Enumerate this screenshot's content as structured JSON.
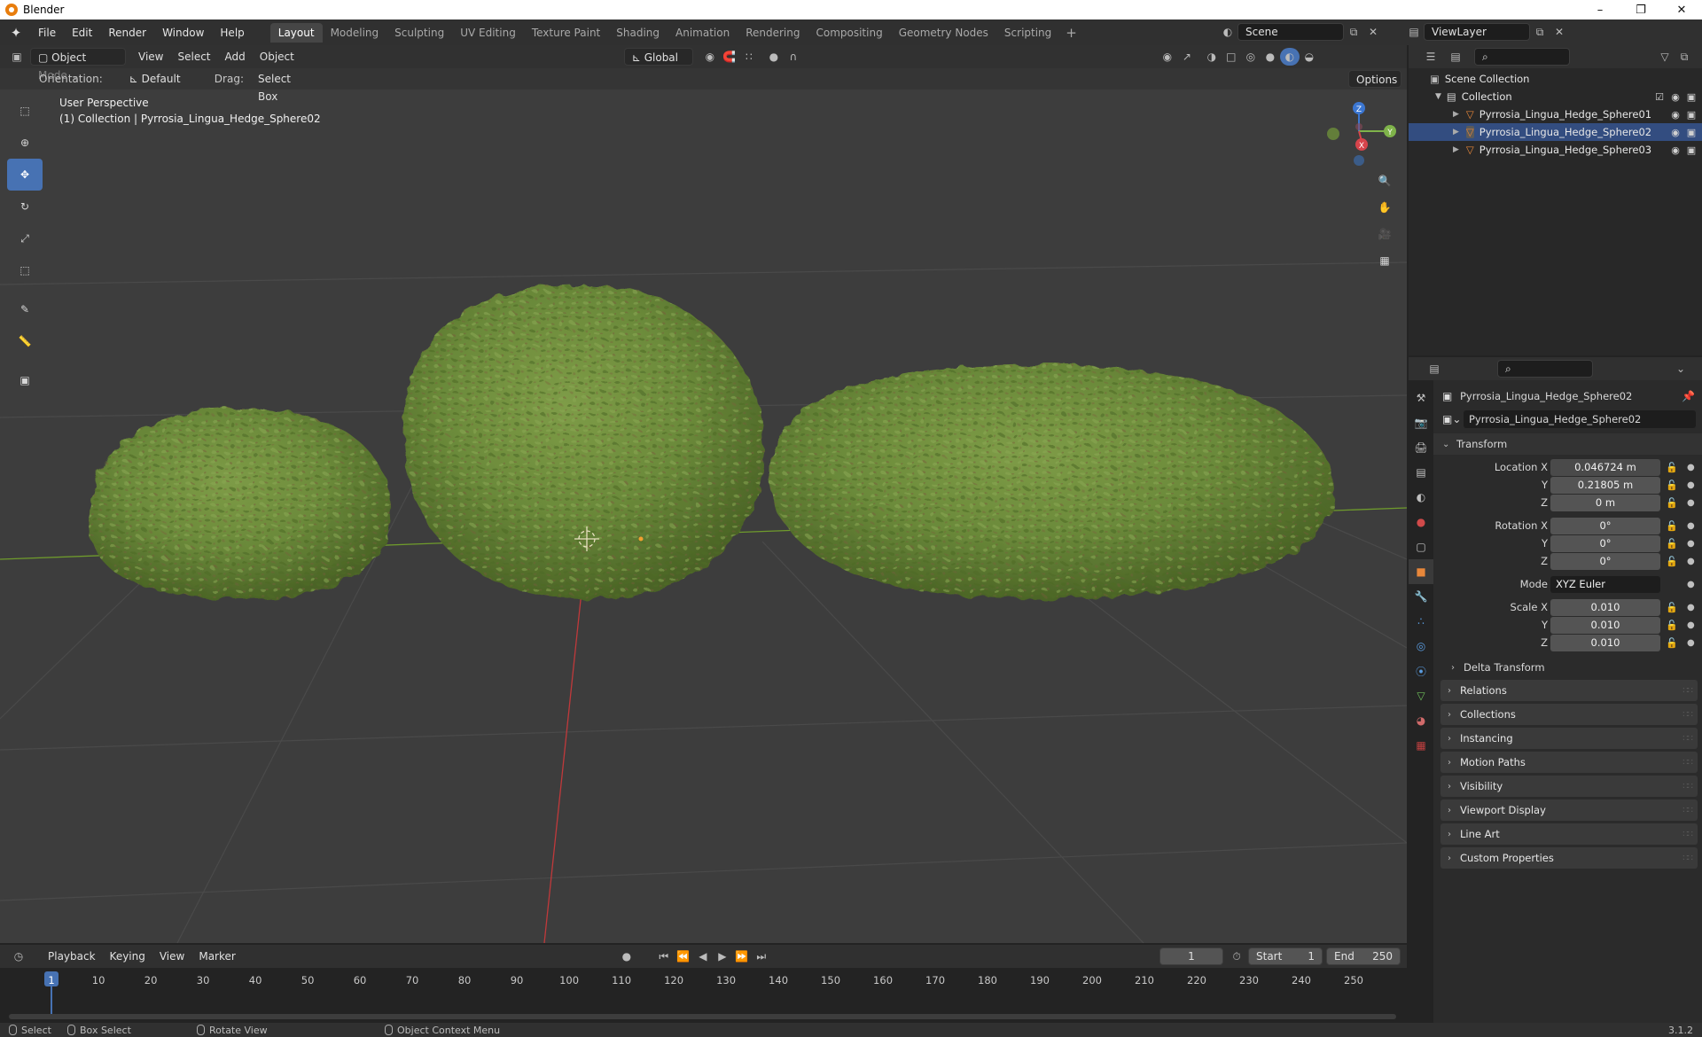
{
  "window": {
    "title": "Blender",
    "minimize": "–",
    "maximize": "❐",
    "close": "✕"
  },
  "topbar": {
    "menus": [
      "File",
      "Edit",
      "Render",
      "Window",
      "Help"
    ],
    "workspaces": [
      "Layout",
      "Modeling",
      "Sculpting",
      "UV Editing",
      "Texture Paint",
      "Shading",
      "Animation",
      "Rendering",
      "Compositing",
      "Geometry Nodes",
      "Scripting"
    ],
    "active_workspace": "Layout",
    "add_workspace": "+",
    "scene": "Scene",
    "view_layer": "ViewLayer"
  },
  "viewport": {
    "mode": "Object Mode",
    "menus": [
      "View",
      "Select",
      "Add",
      "Object"
    ],
    "transform_orientation": "Global",
    "orientation_label": "Orientation:",
    "orientation_value": "Default",
    "drag_label": "Drag:",
    "drag_value": "Select Box",
    "options": "Options",
    "info_line1": "User Perspective",
    "info_line2": "(1) Collection | Pyrrosia_Lingua_Hedge_Sphere02",
    "gizmo": {
      "z": "Z",
      "y": "Y",
      "x": "X"
    },
    "colors": {
      "bg": "#3d3d3d",
      "grid": "#4a4a4a",
      "x_axis": "#c0393b",
      "y_axis": "#6f9b2c",
      "foliage": "#6b8a3a",
      "foliage_dark": "#4e6a28",
      "foliage_brown": "#7a5a3c"
    }
  },
  "outliner": {
    "root": "Scene Collection",
    "collection": "Collection",
    "items": [
      {
        "name": "Pyrrosia_Lingua_Hedge_Sphere01",
        "selected": false
      },
      {
        "name": "Pyrrosia_Lingua_Hedge_Sphere02",
        "selected": true
      },
      {
        "name": "Pyrrosia_Lingua_Hedge_Sphere03",
        "selected": false
      }
    ]
  },
  "properties": {
    "object_name": "Pyrrosia_Lingua_Hedge_Sphere02",
    "object_field": "Pyrrosia_Lingua_Hedge_Sphere02",
    "transform_title": "Transform",
    "location": {
      "label_x": "Location X",
      "label_y": "Y",
      "label_z": "Z",
      "x": "0.046724 m",
      "y": "0.21805 m",
      "z": "0 m"
    },
    "rotation": {
      "label_x": "Rotation X",
      "label_y": "Y",
      "label_z": "Z",
      "x": "0°",
      "y": "0°",
      "z": "0°"
    },
    "mode": {
      "label": "Mode",
      "value": "XYZ Euler"
    },
    "scale": {
      "label_x": "Scale X",
      "label_y": "Y",
      "label_z": "Z",
      "x": "0.010",
      "y": "0.010",
      "z": "0.010"
    },
    "delta_transform": "Delta Transform",
    "panels": [
      "Relations",
      "Collections",
      "Instancing",
      "Motion Paths",
      "Visibility",
      "Viewport Display",
      "Line Art",
      "Custom Properties"
    ]
  },
  "timeline": {
    "menus": [
      "Playback",
      "Keying",
      "View",
      "Marker"
    ],
    "current_frame": "1",
    "start_label": "Start",
    "start": "1",
    "end_label": "End",
    "end": "250",
    "frame_labels": [
      "1",
      "10",
      "20",
      "30",
      "40",
      "50",
      "60",
      "70",
      "80",
      "90",
      "100",
      "110",
      "120",
      "130",
      "140",
      "150",
      "160",
      "170",
      "180",
      "190",
      "200",
      "210",
      "220",
      "230",
      "240",
      "250"
    ]
  },
  "statusbar": {
    "select": "Select",
    "box_select": "Box Select",
    "rotate_view": "Rotate View",
    "context_menu": "Object Context Menu",
    "version": "3.1.2"
  }
}
